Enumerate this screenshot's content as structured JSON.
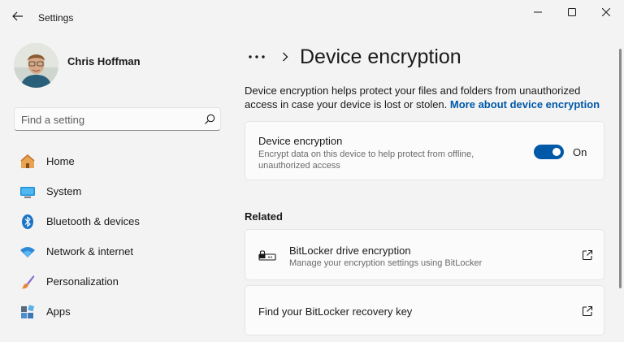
{
  "window": {
    "title": "Settings",
    "controls": [
      "minimize",
      "maximize",
      "close"
    ]
  },
  "user": {
    "name": "Chris Hoffman"
  },
  "search": {
    "placeholder": "Find a setting",
    "value": ""
  },
  "sidebar": {
    "items": [
      {
        "label": "Home",
        "icon": "home-icon"
      },
      {
        "label": "System",
        "icon": "system-icon"
      },
      {
        "label": "Bluetooth & devices",
        "icon": "bluetooth-icon"
      },
      {
        "label": "Network & internet",
        "icon": "wifi-icon"
      },
      {
        "label": "Personalization",
        "icon": "brush-icon"
      },
      {
        "label": "Apps",
        "icon": "apps-icon"
      }
    ]
  },
  "breadcrumb": {
    "more": "...",
    "title": "Device encryption"
  },
  "description": {
    "text": "Device encryption helps protect your files and folders from unauthorized access in case your device is lost or stolen.",
    "link": "More about device encryption"
  },
  "encryption_card": {
    "title": "Device encryption",
    "subtitle": "Encrypt data on this device to help protect from offline, unauthorized access",
    "toggle_on": true,
    "toggle_label": "On"
  },
  "related": {
    "header": "Related",
    "items": [
      {
        "title": "BitLocker drive encryption",
        "subtitle": "Manage your encryption settings using BitLocker"
      },
      {
        "title": "Find your BitLocker recovery key",
        "subtitle": ""
      }
    ]
  },
  "colors": {
    "accent": "#0059a8",
    "background": "#f3f3f3",
    "card": "#fbfbfb"
  }
}
